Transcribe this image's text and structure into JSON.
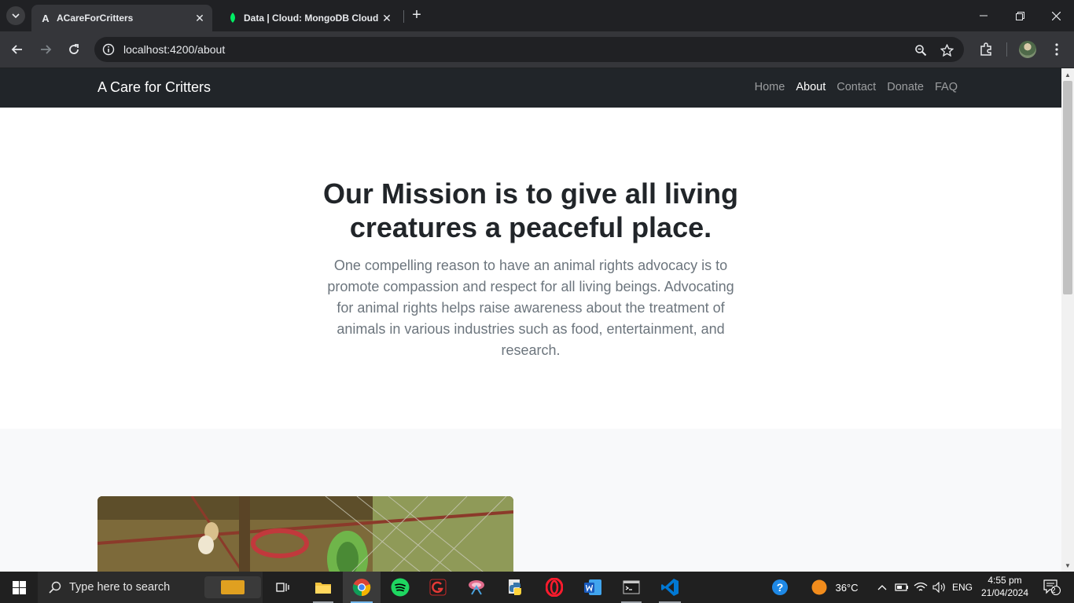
{
  "browser": {
    "tabs": [
      {
        "title": "ACareForCritters",
        "favicon": "A",
        "active": true
      },
      {
        "title": "Data | Cloud: MongoDB Cloud",
        "favicon": "leaf",
        "active": false
      }
    ],
    "url": "localhost:4200/about"
  },
  "site": {
    "brand": "A Care for Critters",
    "nav": [
      "Home",
      "About",
      "Contact",
      "Donate",
      "FAQ"
    ],
    "current_nav": "About"
  },
  "hero": {
    "heading": "Our Mission is to give all living creatures a peaceful place.",
    "body": "One compelling reason to have an animal rights advocacy is to promote compassion and respect for all living beings. Advocating for animal rights helps raise awareness about the treatment of animals in various industries such as food, entertainment, and research."
  },
  "taskbar": {
    "search_placeholder": "Type here to search",
    "temperature": "36°C",
    "language": "ENG",
    "time": "4:55 pm",
    "date": "21/04/2024",
    "notifications": "2"
  }
}
